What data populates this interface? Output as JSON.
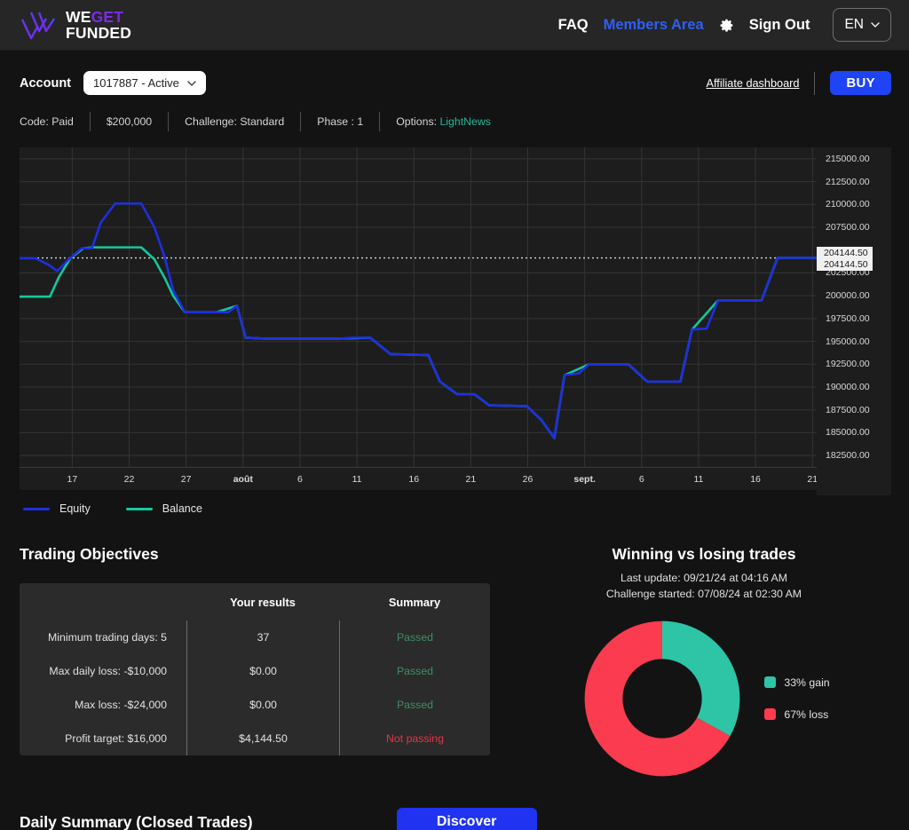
{
  "header": {
    "logo": {
      "line1_a": "WE",
      "line1_b": "GET",
      "line2": "FUNDED",
      "icon": "wegetfunded-logo-icon"
    },
    "nav": [
      {
        "label": "FAQ",
        "accent": false
      },
      {
        "label": "Members Area",
        "accent": true
      },
      {
        "label": "Sign Out",
        "accent": false
      }
    ],
    "settings_icon": "gear-icon",
    "language": {
      "value": "EN",
      "chevron": "chevron-down-icon"
    }
  },
  "account": {
    "label": "Account",
    "selected": "1017887 - Active",
    "affiliate_link": "Affiliate dashboard",
    "buy_label": "BUY",
    "meta": [
      {
        "text": "Code: Paid",
        "green_value": ""
      },
      {
        "text": "$200,000",
        "green_value": ""
      },
      {
        "text": "Challenge: Standard",
        "green_value": ""
      },
      {
        "text": "Phase : 1",
        "green_value": ""
      },
      {
        "text": "Options: ",
        "green_value": "LightNews"
      }
    ]
  },
  "chart_data": {
    "type": "line",
    "title": "",
    "xlabel": "",
    "ylabel": "",
    "ylim": [
      181250,
      216250
    ],
    "ytick_labels": [
      "215000.00",
      "212500.00",
      "210000.00",
      "207500.00",
      "202500.00",
      "200000.00",
      "197500.00",
      "195000.00",
      "192500.00",
      "190000.00",
      "187500.00",
      "185000.00",
      "182500.00"
    ],
    "ytick_values": [
      215000,
      212500,
      210000,
      207500,
      202500,
      200000,
      197500,
      195000,
      192500,
      190000,
      187500,
      185000,
      182500
    ],
    "marker_labels": [
      "204144.50",
      "204144.50"
    ],
    "marker_value": 204144.5,
    "reference_line_value": 204144.5,
    "grid": true,
    "legend_position": "bottom-left",
    "xtick_labels": [
      "17",
      "22",
      "27",
      "août",
      "6",
      "11",
      "16",
      "21",
      "26",
      "sept.",
      "6",
      "11",
      "16",
      "21"
    ],
    "series": [
      {
        "name": "Equity",
        "color": "#1f2fe0",
        "points": [
          [
            0,
            204100
          ],
          [
            1.1,
            204100
          ],
          [
            2.0,
            203400
          ],
          [
            2.6,
            202700
          ],
          [
            3.4,
            204000
          ],
          [
            4.3,
            205200
          ],
          [
            5.0,
            205200
          ],
          [
            5.6,
            208000
          ],
          [
            6.6,
            210100
          ],
          [
            8.4,
            210100
          ],
          [
            9.3,
            207500
          ],
          [
            10.0,
            204300
          ],
          [
            10.6,
            200600
          ],
          [
            11.4,
            198200
          ],
          [
            13.6,
            198200
          ],
          [
            14.4,
            198200
          ],
          [
            15.0,
            198900
          ],
          [
            15.6,
            195400
          ],
          [
            17.0,
            195300
          ],
          [
            22.0,
            195300
          ],
          [
            23.0,
            195400
          ],
          [
            24.2,
            195400
          ],
          [
            25.6,
            193600
          ],
          [
            28.2,
            193500
          ],
          [
            29.0,
            190600
          ],
          [
            30.2,
            189200
          ],
          [
            31.4,
            189200
          ],
          [
            32.4,
            188000
          ],
          [
            35.0,
            187900
          ],
          [
            36.0,
            186400
          ],
          [
            36.9,
            184400
          ],
          [
            37.6,
            191300
          ],
          [
            38.6,
            191500
          ],
          [
            39.3,
            192500
          ],
          [
            42.0,
            192500
          ],
          [
            43.3,
            190600
          ],
          [
            45.6,
            190600
          ],
          [
            46.4,
            196300
          ],
          [
            47.4,
            196400
          ],
          [
            48.2,
            199500
          ],
          [
            51.2,
            199500
          ],
          [
            52.3,
            204144.5
          ],
          [
            55.0,
            204144.5
          ]
        ]
      },
      {
        "name": "Balance",
        "color": "#15c79c",
        "points": [
          [
            0,
            199900
          ],
          [
            2.1,
            199900
          ],
          [
            2.7,
            202000
          ],
          [
            3.5,
            204100
          ],
          [
            4.4,
            205200
          ],
          [
            5.0,
            205300
          ],
          [
            8.4,
            205300
          ],
          [
            9.3,
            204000
          ],
          [
            10.0,
            202000
          ],
          [
            10.6,
            200000
          ],
          [
            11.4,
            198200
          ],
          [
            13.6,
            198200
          ],
          [
            15.0,
            198900
          ],
          [
            15.6,
            195400
          ],
          [
            17.0,
            195300
          ],
          [
            22.0,
            195300
          ],
          [
            24.2,
            195400
          ],
          [
            25.6,
            193600
          ],
          [
            28.2,
            193500
          ],
          [
            29.0,
            190600
          ],
          [
            30.2,
            189200
          ],
          [
            31.4,
            189200
          ],
          [
            32.4,
            188000
          ],
          [
            35.0,
            187900
          ],
          [
            36.0,
            186400
          ],
          [
            36.9,
            184400
          ],
          [
            37.6,
            191300
          ],
          [
            39.3,
            192500
          ],
          [
            42.0,
            192500
          ],
          [
            43.3,
            190600
          ],
          [
            45.6,
            190600
          ],
          [
            46.4,
            196300
          ],
          [
            48.2,
            199500
          ],
          [
            51.2,
            199500
          ],
          [
            52.3,
            204144.5
          ],
          [
            55.0,
            204144.5
          ]
        ]
      }
    ],
    "legend": [
      {
        "label": "Equity",
        "color": "#1f2fe0"
      },
      {
        "label": "Balance",
        "color": "#15c79c"
      }
    ]
  },
  "objectives": {
    "title": "Trading Objectives",
    "columns": [
      "",
      "Your results",
      "Summary"
    ],
    "rows": [
      {
        "criterion": "Minimum trading days: 5",
        "result": "37",
        "summary": "Passed",
        "state": "pass"
      },
      {
        "criterion": "Max daily loss: -$10,000",
        "result": "$0.00",
        "summary": "Passed",
        "state": "pass"
      },
      {
        "criterion": "Max loss: -$24,000",
        "result": "$0.00",
        "summary": "Passed",
        "state": "pass"
      },
      {
        "criterion": "Profit target: $16,000",
        "result": "$4,144.50",
        "summary": "Not passing",
        "state": "fail"
      }
    ]
  },
  "winloss": {
    "title": "Winning vs losing trades",
    "last_update": "Last update: 09/21/24 at 04:16 AM",
    "challenge_started": "Challenge started: 07/08/24 at 02:30 AM",
    "donut": {
      "type": "pie",
      "slices": [
        {
          "label": "33% gain",
          "value": 33,
          "color": "#2ec4a6"
        },
        {
          "label": "67% loss",
          "value": 67,
          "color": "#fb3b4f"
        }
      ]
    }
  },
  "bottom": {
    "daily_summary_title": "Daily Summary (Closed Trades)",
    "discover_label": "Discover"
  }
}
